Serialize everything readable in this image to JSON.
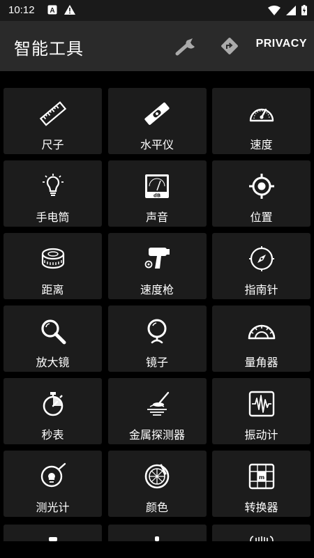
{
  "status_bar": {
    "time": "10:12"
  },
  "app_bar": {
    "title": "智能工具",
    "privacy_label": "PRIVACY"
  },
  "tools": [
    {
      "label": "尺子",
      "icon": "ruler-icon"
    },
    {
      "label": "水平仪",
      "icon": "level-icon"
    },
    {
      "label": "速度",
      "icon": "speedometer-icon"
    },
    {
      "label": "手电筒",
      "icon": "flashlight-icon"
    },
    {
      "label": "声音",
      "icon": "decibel-meter-icon"
    },
    {
      "label": "位置",
      "icon": "location-target-icon"
    },
    {
      "label": "距离",
      "icon": "tape-measure-icon"
    },
    {
      "label": "速度枪",
      "icon": "speed-gun-icon"
    },
    {
      "label": "指南针",
      "icon": "compass-icon"
    },
    {
      "label": "放大镜",
      "icon": "magnifier-icon"
    },
    {
      "label": "镜子",
      "icon": "mirror-icon"
    },
    {
      "label": "量角器",
      "icon": "protractor-icon"
    },
    {
      "label": "秒表",
      "icon": "stopwatch-icon"
    },
    {
      "label": "金属探测器",
      "icon": "metal-detector-icon"
    },
    {
      "label": "振动计",
      "icon": "vibration-meter-icon"
    },
    {
      "label": "测光计",
      "icon": "light-meter-icon"
    },
    {
      "label": "颜色",
      "icon": "color-palette-icon"
    },
    {
      "label": "转换器",
      "icon": "unit-converter-icon"
    }
  ],
  "colors": {
    "background": "#000000",
    "tile": "#1c1c1c",
    "app_bar": "#2a2a2a"
  }
}
